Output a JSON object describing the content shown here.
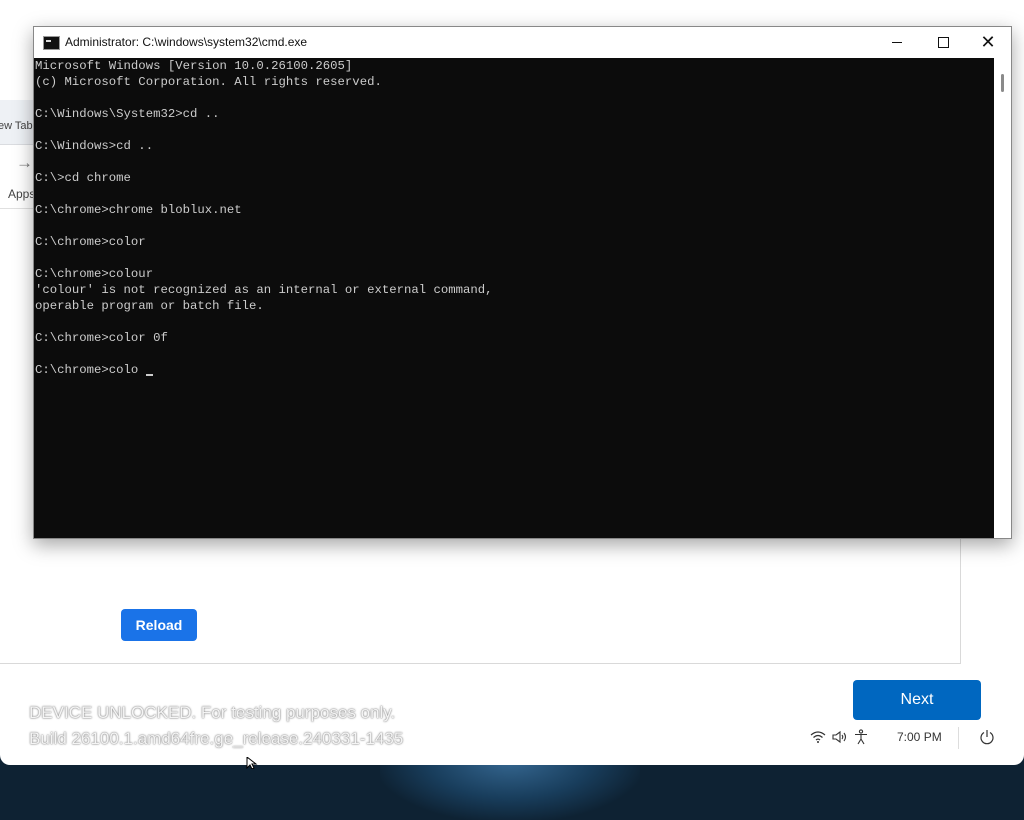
{
  "browser": {
    "tab_label": "ew Tab",
    "forward_icon": "arrow-right-icon",
    "apps_label": "Apps",
    "reload_label": "Reload"
  },
  "cmd": {
    "title": "Administrator: C:\\windows\\system32\\cmd.exe",
    "lines": [
      "Microsoft Windows [Version 10.0.26100.2605]",
      "(c) Microsoft Corporation. All rights reserved.",
      "",
      "C:\\Windows\\System32>cd ..",
      "",
      "C:\\Windows>cd ..",
      "",
      "C:\\>cd chrome",
      "",
      "C:\\chrome>chrome bloblux.net",
      "",
      "C:\\chrome>color",
      "",
      "C:\\chrome>colour",
      "'colour' is not recognized as an internal or external command,",
      "operable program or batch file.",
      "",
      "C:\\chrome>color 0f",
      "",
      "C:\\chrome>colo "
    ],
    "colors": {
      "background": "#0c0c0c",
      "text": "#cccccc"
    }
  },
  "footer": {
    "device_line1": "DEVICE UNLOCKED. For testing purposes only.",
    "device_line2": "Build 26100.1.amd64fre.ge_release.240331-1435",
    "next_label": "Next",
    "time": "7:00 PM",
    "icons": [
      "wifi-icon",
      "volume-icon",
      "accessibility-icon",
      "power-icon"
    ]
  },
  "colors": {
    "accent": "#0067c0",
    "reload": "#1a73e8"
  }
}
